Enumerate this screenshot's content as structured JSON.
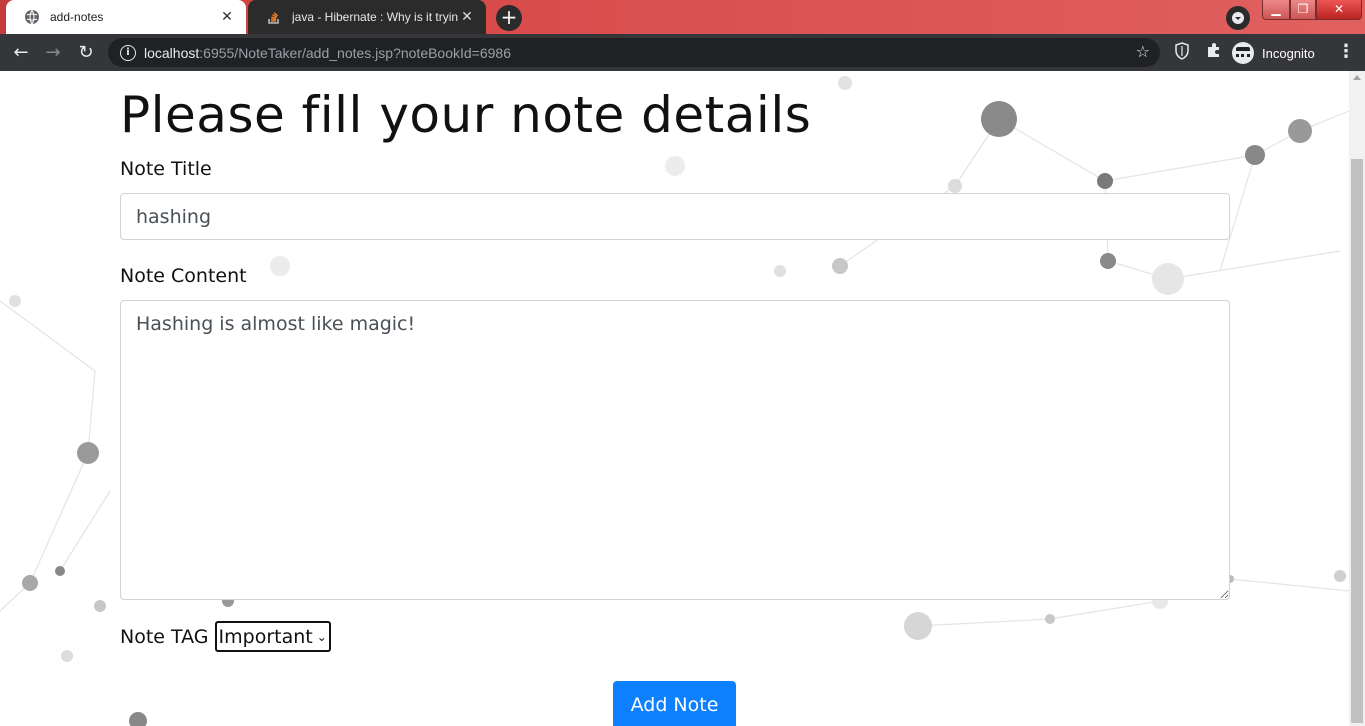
{
  "tabs": [
    {
      "title": "add-notes",
      "active": true,
      "icon": "globe-icon"
    },
    {
      "title": "java - Hibernate : Why is it trying",
      "active": false,
      "icon": "stackoverflow-icon"
    }
  ],
  "toolbar": {
    "url_host": "localhost",
    "url_rest": ":6955/NoteTaker/add_notes.jsp?noteBookId=6986",
    "profile_label": "Incognito"
  },
  "page": {
    "heading": "Please fill your note details",
    "title_label": "Note Title",
    "title_value": "hashing",
    "content_label": "Note Content",
    "content_value": "Hashing is almost like magic!",
    "tag_label": "Note TAG",
    "tag_selected": "Important",
    "submit_label": "Add Note"
  },
  "colors": {
    "tabstrip": "#d94d4d",
    "toolbar": "#35363a",
    "primary_button": "#0d80ff"
  }
}
